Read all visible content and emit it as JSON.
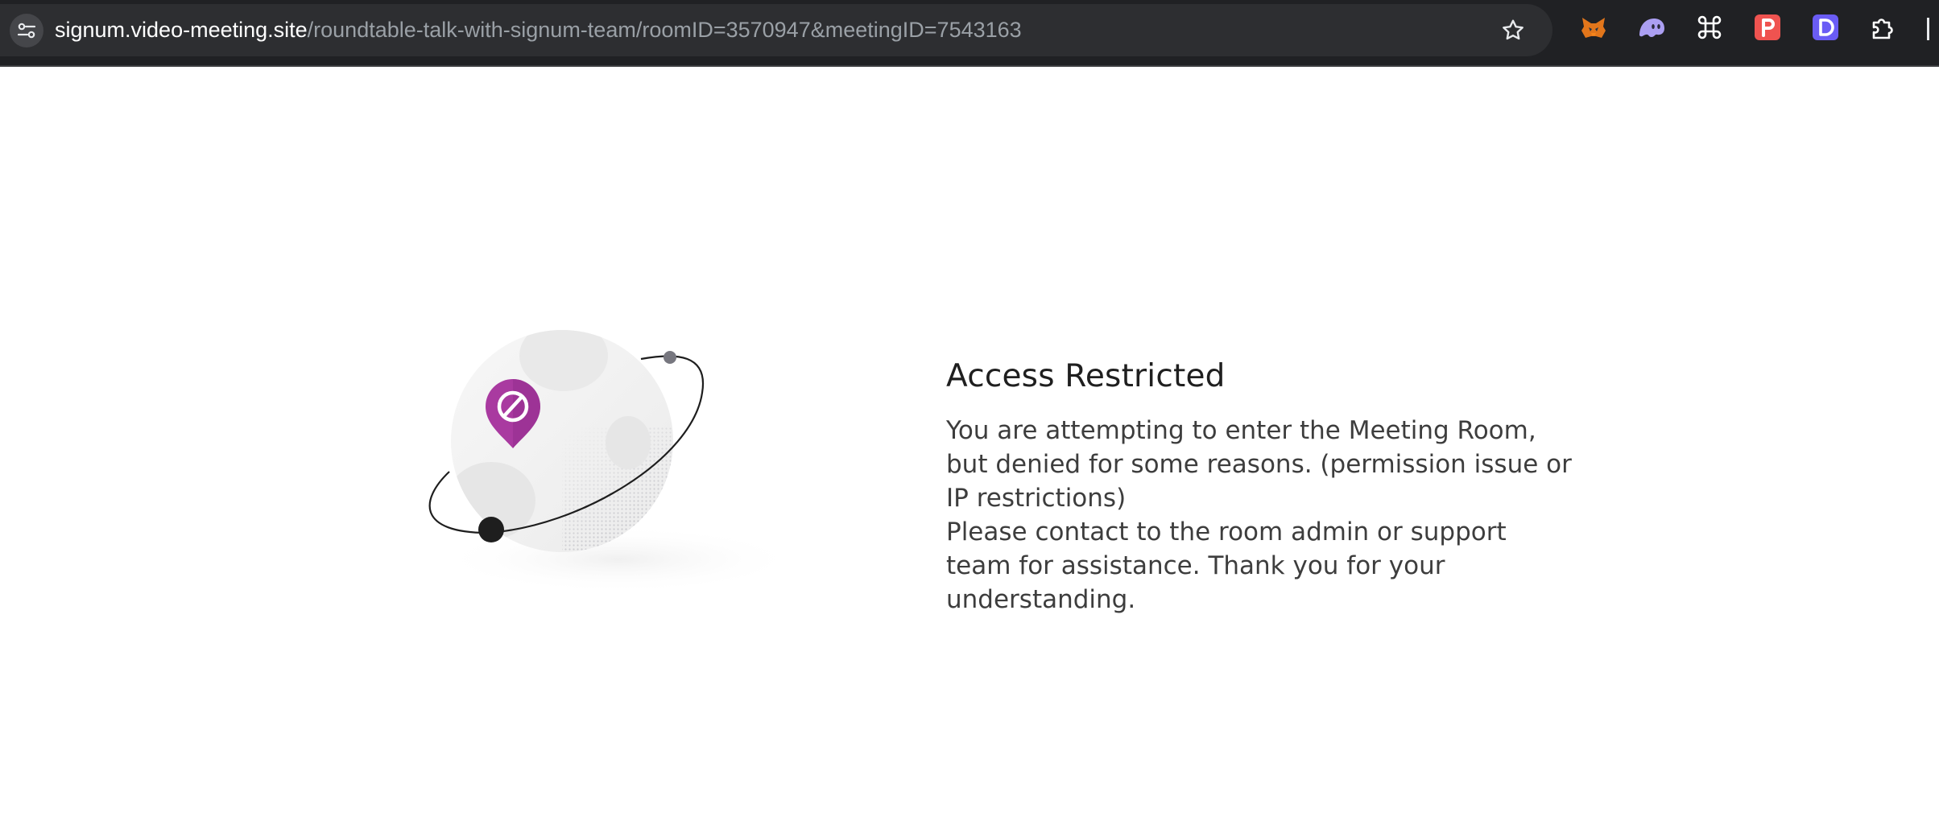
{
  "browser": {
    "url_host": "signum.video-meeting.site",
    "url_path": "/roundtable-talk-with-signum-team/roomID=3570947&meetingID=7543163",
    "site_info_icon": "tune-icon",
    "bookmark_icon": "star-outline-icon",
    "extensions": [
      {
        "name": "metamask-fox-icon",
        "color": "#e2761b"
      },
      {
        "name": "phantom-ghost-icon",
        "color": "#ab9ff2"
      },
      {
        "name": "command-key-icon",
        "color": "#ffffff"
      },
      {
        "name": "p-badge-icon",
        "color": "#ef5350"
      },
      {
        "name": "d-badge-icon",
        "color": "#6a5cf5"
      },
      {
        "name": "puzzle-extensions-icon",
        "color": "#ffffff"
      }
    ]
  },
  "page": {
    "title": "Access Restricted",
    "message_line_1": "You are attempting to enter the Meeting Room, but denied for some reasons. (permission issue or IP restrictions)",
    "message_line_2": "Please contact to the room admin or support team for assistance. Thank you for your understanding.",
    "illustration": "planet-with-blocked-pin-illustration",
    "accent_color": "#a93aa0"
  }
}
